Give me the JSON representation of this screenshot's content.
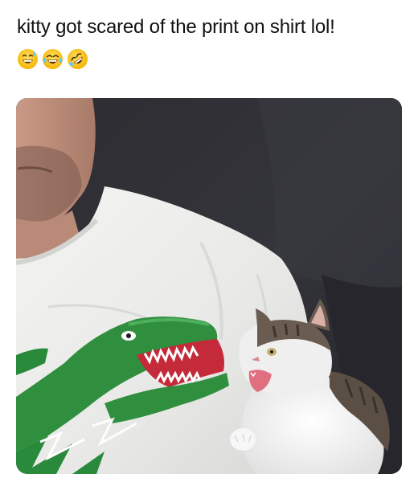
{
  "post": {
    "caption": "kitty got scared of the print on shirt lol!",
    "emojis": [
      "grinning-sweat-emoji",
      "tears-of-joy-emoji",
      "rolling-on-floor-laughing-emoji"
    ]
  },
  "photo": {
    "subjects": [
      "man",
      "white-shirt",
      "crocodile-print",
      "kitten"
    ]
  }
}
